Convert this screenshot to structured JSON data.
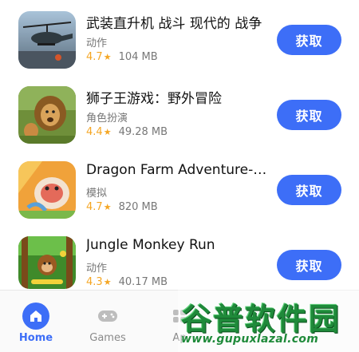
{
  "apps": [
    {
      "title": "武装直升机 战斗 现代的 战争",
      "category": "动作",
      "rating": "4.7",
      "size": "104 MB",
      "button_label": "获取",
      "icon": "helicopter-game-icon"
    },
    {
      "title": "狮子王游戏：野外冒险",
      "category": "角色扮演",
      "rating": "4.4",
      "size": "49.28 MB",
      "button_label": "获取",
      "icon": "lion-game-icon"
    },
    {
      "title": "Dragon Farm Adventure-Fun Games",
      "category": "模拟",
      "rating": "4.7",
      "size": "820 MB",
      "button_label": "获取",
      "icon": "dragon-game-icon"
    },
    {
      "title": "Jungle Monkey Run",
      "category": "动作",
      "rating": "4.3",
      "size": "40.17 MB",
      "button_label": "获取",
      "icon": "monkey-game-icon"
    }
  ],
  "star_glyph": "★",
  "bottom_nav": {
    "items": [
      {
        "label": "Home",
        "icon": "home-icon",
        "active": true
      },
      {
        "label": "Games",
        "icon": "gamepad-icon",
        "active": false
      },
      {
        "label": "Ap",
        "icon": "apps-icon",
        "active": false
      }
    ]
  },
  "watermark": {
    "title": "谷普软件园",
    "url": "www.gupuxlazal.com"
  },
  "colors": {
    "accent": "#3d6ef7",
    "rating": "#f5a623",
    "watermark": "#1f8a3a"
  }
}
